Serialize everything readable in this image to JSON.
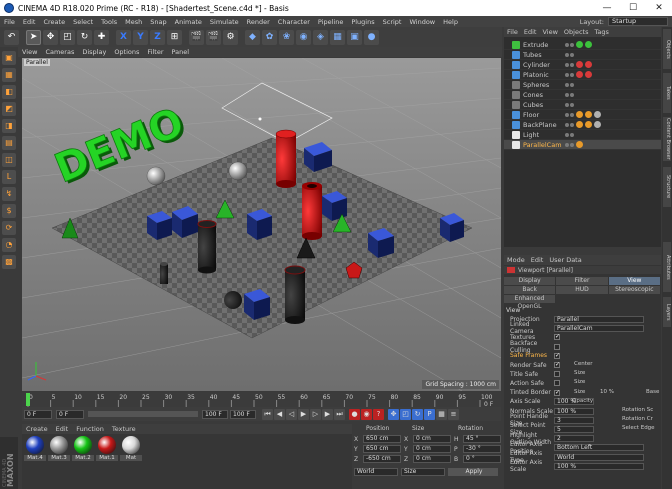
{
  "window": {
    "title": "CINEMA 4D R18.020 Prime (RC - R18) - [Shadertest_Scene.c4d *] - Basis",
    "controls": [
      "—",
      "☐",
      "✕"
    ]
  },
  "menubar": {
    "items": [
      "File",
      "Edit",
      "Create",
      "Select",
      "Tools",
      "Mesh",
      "Snap",
      "Animate",
      "Simulate",
      "Render",
      "Character",
      "Pipeline",
      "Plugins",
      "Script",
      "Window",
      "Help"
    ],
    "layout_label": "Layout:",
    "layout_value": "Startup"
  },
  "toolbar": {
    "icons": [
      {
        "name": "undo-icon",
        "glyph": "↶"
      },
      {
        "name": "select-arrow-icon",
        "glyph": "➤"
      },
      {
        "name": "move-icon",
        "glyph": "✥"
      },
      {
        "name": "scale-icon",
        "glyph": "◰"
      },
      {
        "name": "rotate-icon",
        "glyph": "↻"
      },
      {
        "name": "live-select-icon",
        "glyph": "✚"
      },
      {
        "name": "x-axis-icon",
        "glyph": "X"
      },
      {
        "name": "y-axis-icon",
        "glyph": "Y"
      },
      {
        "name": "z-axis-icon",
        "glyph": "Z"
      },
      {
        "name": "coord-system-icon",
        "glyph": "⊞"
      },
      {
        "name": "render-view-icon",
        "glyph": "🎬"
      },
      {
        "name": "render-picture-icon",
        "glyph": "🎬"
      },
      {
        "name": "render-settings-icon",
        "glyph": "⚙"
      },
      {
        "name": "cube-icon",
        "glyph": "◆"
      },
      {
        "name": "nurbs-icon",
        "glyph": "✿"
      },
      {
        "name": "spline-icon",
        "glyph": "❀"
      },
      {
        "name": "subdivision-icon",
        "glyph": "◉"
      },
      {
        "name": "deformer-icon",
        "glyph": "◈"
      },
      {
        "name": "scene-icon",
        "glyph": "▦"
      },
      {
        "name": "camera-icon",
        "glyph": "▣"
      },
      {
        "name": "light-icon",
        "glyph": "●"
      }
    ]
  },
  "left_tools": [
    "▣",
    "▦",
    "◧",
    "◩",
    "◨",
    "▤",
    "◫",
    "L",
    "↯",
    "$",
    "⟳",
    "◔",
    "▩"
  ],
  "viewport": {
    "menu": [
      "View",
      "Cameras",
      "Display",
      "Options",
      "Filter",
      "Panel"
    ],
    "label": "Parallel",
    "grid_info": "Grid Spacing : 1000 cm",
    "demo_text": "DEMO"
  },
  "timeline": {
    "ticks": [
      "0",
      "5",
      "10",
      "15",
      "20",
      "25",
      "30",
      "35",
      "40",
      "45",
      "50",
      "55",
      "60",
      "65",
      "70",
      "75",
      "80",
      "85",
      "90",
      "95",
      "100"
    ],
    "frame_end_label": "0 F"
  },
  "transport": {
    "start": "0 F",
    "current": "0 F",
    "end": "100 F",
    "max": "100 F"
  },
  "materials": {
    "menu": [
      "Create",
      "Edit",
      "Function",
      "Texture"
    ],
    "items": [
      {
        "label": "Mat.4",
        "color": "#1e3fbf"
      },
      {
        "label": "Mat.3",
        "color": "#9a9a9a"
      },
      {
        "label": "Mat.2",
        "color": "#14c414"
      },
      {
        "label": "Mat.1",
        "color": "#c81818"
      },
      {
        "label": "Mat",
        "color": "#d8d8d8"
      }
    ]
  },
  "coordinates": {
    "headers": [
      "Position",
      "Size",
      "Rotation"
    ],
    "rows": [
      {
        "axis": "X",
        "pos": "650 cm",
        "size_axis": "X",
        "size": "0 cm",
        "rot_axis": "H",
        "rot": "45 °"
      },
      {
        "axis": "Y",
        "pos": "650 cm",
        "size_axis": "Y",
        "size": "0 cm",
        "rot_axis": "P",
        "rot": "-30 °"
      },
      {
        "axis": "Z",
        "pos": "-650 cm",
        "size_axis": "Z",
        "size": "0 cm",
        "rot_axis": "B",
        "rot": "0 °"
      }
    ],
    "mode": "World",
    "size_mode": "Size",
    "apply": "Apply"
  },
  "objects": {
    "menu": [
      "File",
      "Edit",
      "View",
      "Objects",
      "Tags"
    ],
    "items": [
      {
        "name": "Extrude",
        "icon": "#3fbf3f",
        "tags": [
          "#3cc23c",
          "#3cc23c"
        ],
        "selected": false
      },
      {
        "name": "Tubes",
        "icon": "#4a90d9",
        "tags": [],
        "selected": false
      },
      {
        "name": "Cylinder",
        "icon": "#4a90d9",
        "tags": [
          "#d83a3a",
          "#d83a3a"
        ],
        "selected": false
      },
      {
        "name": "Platonic",
        "icon": "#4a90d9",
        "tags": [
          "#d83a3a",
          "#d83a3a"
        ],
        "selected": false
      },
      {
        "name": "Spheres",
        "icon": "#7a7a7a",
        "tags": [],
        "selected": false
      },
      {
        "name": "Cones",
        "icon": "#7a7a7a",
        "tags": [],
        "selected": false
      },
      {
        "name": "Cubes",
        "icon": "#7a7a7a",
        "tags": [],
        "selected": false
      },
      {
        "name": "Floor",
        "icon": "#4a90d9",
        "tags": [
          "#e89a2a",
          "#e89a2a",
          "#b0b0b0"
        ],
        "selected": false
      },
      {
        "name": "BackPlane",
        "icon": "#4a90d9",
        "tags": [
          "#e89a2a",
          "#e89a2a",
          "#b0b0b0"
        ],
        "selected": false
      },
      {
        "name": "Light",
        "icon": "#e8e8e8",
        "tags": [],
        "selected": false
      },
      {
        "name": "ParallelCam",
        "icon": "#e8e8e8",
        "tags": [
          "#e89a2a"
        ],
        "selected": true
      }
    ]
  },
  "attributes": {
    "menu": [
      "Mode",
      "Edit",
      "User Data"
    ],
    "title": "Viewport [Parallel]",
    "tabs_row1": [
      "Display",
      "Filter",
      "View"
    ],
    "tabs_row2": [
      "Back",
      "HUD",
      "Stereoscopic"
    ],
    "tab_enhanced": "Enhanced OpenGL",
    "section": "View",
    "rows": [
      {
        "label": "Projection",
        "value": "Parallel",
        "type": "field"
      },
      {
        "label": "Linked Camera",
        "value": "ParallelCam",
        "type": "field"
      },
      {
        "label": "Textures",
        "value": "✓",
        "type": "check"
      },
      {
        "label": "Backface Culling",
        "value": "",
        "type": "check"
      },
      {
        "label": "Safe Frames",
        "value": "✓",
        "type": "check"
      },
      {
        "label": "Render Safe",
        "value": "✓",
        "type": "check"
      },
      {
        "label": "Title Safe",
        "value": "",
        "type": "check"
      },
      {
        "label": "Action Safe",
        "value": "",
        "type": "check"
      },
      {
        "label": "Tinted Border",
        "value": "✓",
        "type": "check"
      },
      {
        "label": "Axis Scale",
        "value": "100 %",
        "type": "field"
      },
      {
        "label": "Normals Scale",
        "value": "100 %",
        "type": "field"
      },
      {
        "label": "Point Handle Size",
        "value": "3",
        "type": "field"
      },
      {
        "label": "Select Point Size",
        "value": "5",
        "type": "field"
      },
      {
        "label": "Highlight Outline Width",
        "value": "2",
        "type": "field"
      },
      {
        "label": "Editor Axis Position",
        "value": "Bottom Left",
        "type": "field"
      },
      {
        "label": "Editor Axis Type",
        "value": "World",
        "type": "field"
      },
      {
        "label": "Editor Axis Scale",
        "value": "100 %",
        "type": "field"
      }
    ],
    "side_labels": [
      "Center",
      "Size",
      "Size",
      "Size",
      "Opacity",
      "Rotation Sc",
      "Rotation Cr",
      "Select Edge"
    ],
    "side_values": [
      "10 %",
      "Base"
    ]
  },
  "right_tabs": [
    "Objects",
    "Takes",
    "Content Browser",
    "Structure",
    "Attributes",
    "Layers"
  ]
}
